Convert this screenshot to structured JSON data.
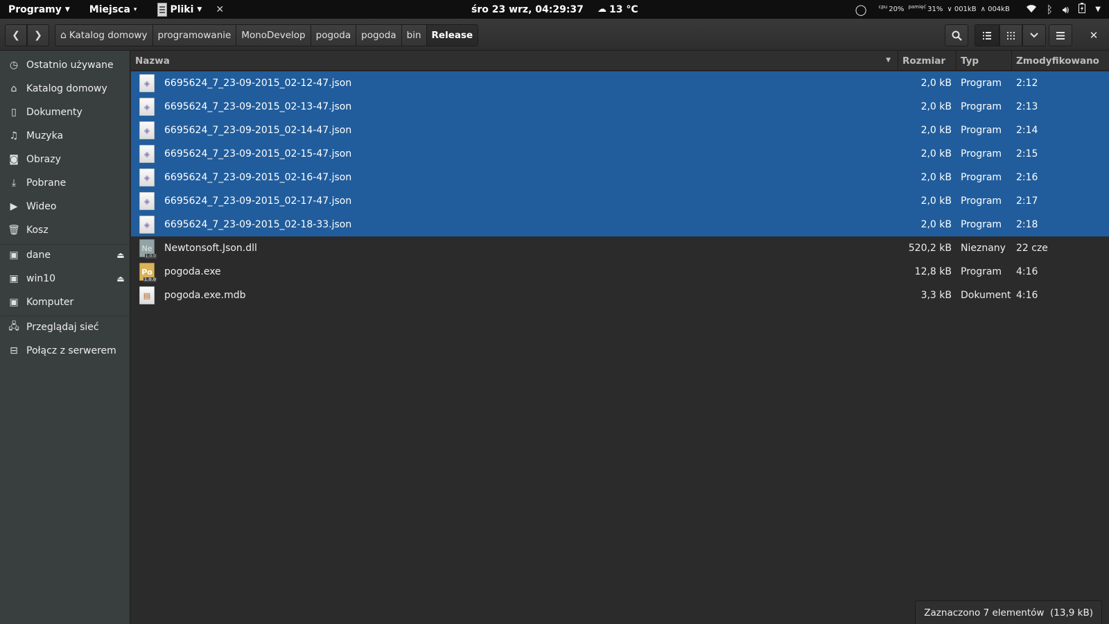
{
  "top_panel": {
    "menu_programy": "Programy",
    "menu_miejsca": "Miejsca",
    "app_name": "Pliki",
    "clock": "śro 23 wrz, 04:29:37",
    "weather": "13 °C",
    "sysmon": {
      "cpu_label": "cpu",
      "cpu_value": "20%",
      "mem_label": "pamięć",
      "mem_value": "31%",
      "net_down": "∨ 001kB",
      "net_up": "∧ 004kB"
    }
  },
  "header": {
    "breadcrumbs": [
      "Katalog domowy",
      "programowanie",
      "MonoDevelop",
      "pogoda",
      "pogoda",
      "bin",
      "Release"
    ]
  },
  "sidebar": {
    "items": [
      {
        "label": "Ostatnio używane",
        "icon": "clock-icon"
      },
      {
        "label": "Katalog domowy",
        "icon": "home-icon"
      },
      {
        "label": "Dokumenty",
        "icon": "document-icon"
      },
      {
        "label": "Muzyka",
        "icon": "music-icon"
      },
      {
        "label": "Obrazy",
        "icon": "camera-icon"
      },
      {
        "label": "Pobrane",
        "icon": "download-icon"
      },
      {
        "label": "Wideo",
        "icon": "video-icon"
      },
      {
        "label": "Kosz",
        "icon": "trash-icon"
      },
      {
        "label": "dane",
        "icon": "drive-icon"
      },
      {
        "label": "win10",
        "icon": "drive-icon"
      },
      {
        "label": "Komputer",
        "icon": "drive-icon"
      },
      {
        "label": "Przeglądaj sieć",
        "icon": "network-icon"
      },
      {
        "label": "Połącz z serwerem",
        "icon": "server-icon"
      }
    ]
  },
  "columns": {
    "name": "Nazwa",
    "size": "Rozmiar",
    "type": "Typ",
    "modified": "Zmodyfikowano"
  },
  "files": [
    {
      "name": "6695624_7_23-09-2015_02-12-47.json",
      "size": "2,0 kB",
      "type": "Program",
      "modified": "2:12",
      "selected": true,
      "icon": "json-file-icon"
    },
    {
      "name": "6695624_7_23-09-2015_02-13-47.json",
      "size": "2,0 kB",
      "type": "Program",
      "modified": "2:13",
      "selected": true,
      "icon": "json-file-icon"
    },
    {
      "name": "6695624_7_23-09-2015_02-14-47.json",
      "size": "2,0 kB",
      "type": "Program",
      "modified": "2:14",
      "selected": true,
      "icon": "json-file-icon"
    },
    {
      "name": "6695624_7_23-09-2015_02-15-47.json",
      "size": "2,0 kB",
      "type": "Program",
      "modified": "2:15",
      "selected": true,
      "icon": "json-file-icon"
    },
    {
      "name": "6695624_7_23-09-2015_02-16-47.json",
      "size": "2,0 kB",
      "type": "Program",
      "modified": "2:16",
      "selected": true,
      "icon": "json-file-icon"
    },
    {
      "name": "6695624_7_23-09-2015_02-17-47.json",
      "size": "2,0 kB",
      "type": "Program",
      "modified": "2:17",
      "selected": true,
      "icon": "json-file-icon"
    },
    {
      "name": "6695624_7_23-09-2015_02-18-33.json",
      "size": "2,0 kB",
      "type": "Program",
      "modified": "2:18",
      "selected": true,
      "icon": "json-file-icon"
    },
    {
      "name": "Newtonsoft.Json.dll",
      "size": "520,2 kB",
      "type": "Nieznany",
      "modified": "22 cze",
      "selected": false,
      "icon": "dll-file-icon",
      "icon_text": "Ne"
    },
    {
      "name": "pogoda.exe",
      "size": "12,8 kB",
      "type": "Program",
      "modified": "4:16",
      "selected": false,
      "icon": "exe-file-icon",
      "icon_text": "Po"
    },
    {
      "name": "pogoda.exe.mdb",
      "size": "3,3 kB",
      "type": "Dokument",
      "modified": "4:16",
      "selected": false,
      "icon": "mdb-file-icon"
    }
  ],
  "status": "Zaznaczono 7 elementów  (13,9 kB)",
  "colors": {
    "selection": "#215d9c",
    "sidebar_bg": "#393f3f",
    "main_bg": "#2b2b2b",
    "panel_bg": "#0f0f0f"
  }
}
